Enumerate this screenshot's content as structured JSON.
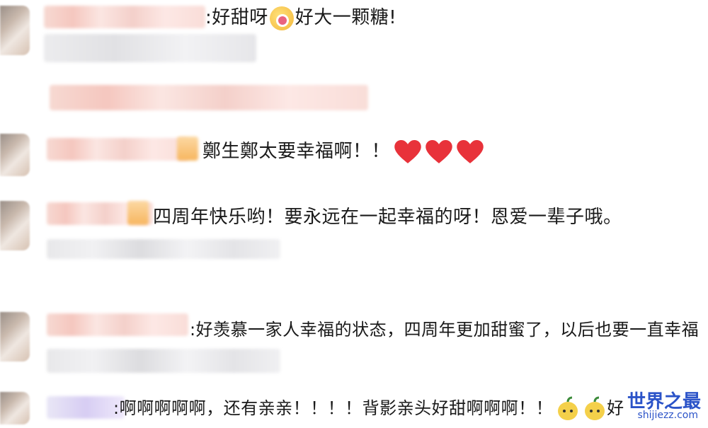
{
  "comments": [
    {
      "prefix": ":好甜呀",
      "suffix": "好大一颗糖!",
      "emoji": "candy-emoji"
    },
    {
      "text": "鄭生鄭太要幸福啊！！",
      "emoji": "heart-emoji"
    },
    {
      "text": "四周年快乐哟！要永远在一起幸福的呀！恩爱一辈子哦。"
    },
    {
      "text": ":好羡慕一家人幸福的状态，四周年更加甜蜜了，以后也要一直幸福"
    },
    {
      "text": ":啊啊啊啊啊，还有亲亲！！！！背影亲头好甜啊啊啊！！",
      "emoji": "pear-emoji",
      "tail": "好"
    }
  ],
  "watermark": {
    "title": "世界之最",
    "url": "shijiezz.com"
  },
  "colors": {
    "heart": "#e8323a",
    "watermark": "#2b53c8"
  }
}
